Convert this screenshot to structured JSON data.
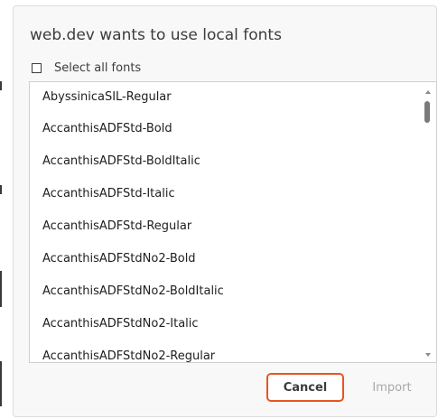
{
  "dialog": {
    "title": "web.dev wants to use local fonts",
    "select_all_label": "Select all fonts",
    "select_all_checked": false,
    "fonts": [
      "AbyssinicaSIL-Regular",
      "AccanthisADFStd-Bold",
      "AccanthisADFStd-BoldItalic",
      "AccanthisADFStd-Italic",
      "AccanthisADFStd-Regular",
      "AccanthisADFStdNo2-Bold",
      "AccanthisADFStdNo2-BoldItalic",
      "AccanthisADFStdNo2-Italic",
      "AccanthisADFStdNo2-Regular"
    ],
    "cancel_label": "Cancel",
    "import_label": "Import"
  },
  "colors": {
    "accent": "#e95420",
    "disabled_text": "#a8a8a8"
  }
}
